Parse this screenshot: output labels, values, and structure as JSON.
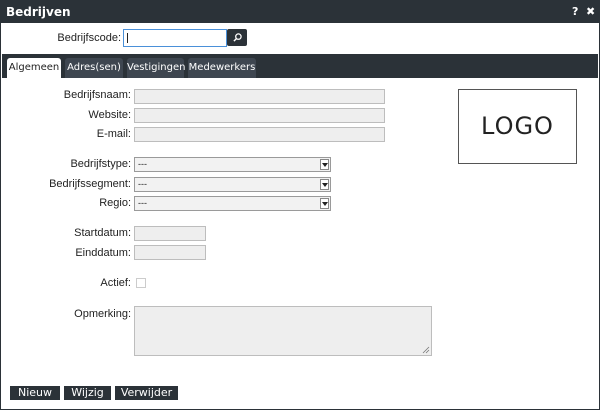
{
  "window": {
    "title": "Bedrijven",
    "help_label": "?",
    "close_label": "✖"
  },
  "search": {
    "label": "Bedrijfscode:",
    "value": "",
    "button_icon": "search-icon"
  },
  "tabs": [
    {
      "label": "Algemeen",
      "active": true
    },
    {
      "label": "Adres(sen)",
      "active": false
    },
    {
      "label": "Vestigingen",
      "active": false
    },
    {
      "label": "Medewerkers",
      "active": false
    }
  ],
  "form": {
    "bedrijfsnaam_label": "Bedrijfsnaam:",
    "website_label": "Website:",
    "email_label": "E-mail:",
    "bedrijfstype_label": "Bedrijfstype:",
    "bedrijfstype_value": "---",
    "bedrijfssegment_label": "Bedrijfssegment:",
    "bedrijfssegment_value": "---",
    "regio_label": "Regio:",
    "regio_value": "---",
    "startdatum_label": "Startdatum:",
    "einddatum_label": "Einddatum:",
    "actief_label": "Actief:",
    "opmerking_label": "Opmerking:"
  },
  "logo": {
    "text": "LOGO"
  },
  "buttons": {
    "nieuw": "Nieuw",
    "wijzig": "Wijzig",
    "verwijder": "Verwijder"
  },
  "colors": {
    "dark": "#2b3238",
    "field_bg": "#eeeeee",
    "focus": "#4a90d9"
  }
}
